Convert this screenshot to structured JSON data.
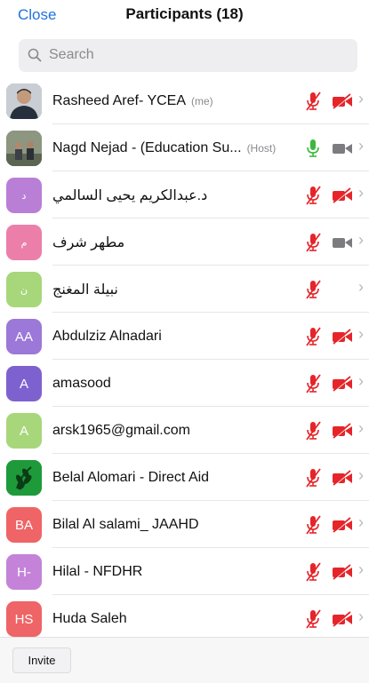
{
  "header": {
    "close_label": "Close",
    "title": "Participants (18)"
  },
  "search": {
    "placeholder": "Search",
    "icon": "search-icon"
  },
  "colors": {
    "accent": "#1f72e0",
    "muted_red": "#e5252a",
    "unmuted_green": "#3cb93c",
    "cam_off_red": "#e5252a",
    "cam_on_gray": "#7b7b80"
  },
  "participants": [
    {
      "name": "Rasheed Aref- YCEA",
      "tag": "(me)",
      "avatar_text": "",
      "avatar_kind": "photo-man",
      "avatar_color": "#5a6b7d",
      "mic": "muted",
      "cam": "off"
    },
    {
      "name": "Nagd Nejad - (Education Su...",
      "tag": "(Host)",
      "avatar_text": "",
      "avatar_kind": "photo-group",
      "avatar_color": "#6f7a64",
      "mic": "on",
      "cam": "on"
    },
    {
      "name": "د.عبدالكريم يحيى السالمي",
      "tag": "",
      "avatar_text": "د",
      "avatar_kind": "initials",
      "avatar_color": "#b97fd6",
      "mic": "muted",
      "cam": "off"
    },
    {
      "name": "مطهر شرف",
      "tag": "",
      "avatar_text": "م",
      "avatar_kind": "initials",
      "avatar_color": "#ec7fa9",
      "mic": "muted",
      "cam": "on"
    },
    {
      "name": "نبيلة المغنج",
      "tag": "",
      "avatar_text": "ن",
      "avatar_kind": "initials",
      "avatar_color": "#a7d77a",
      "mic": "muted",
      "cam": "none"
    },
    {
      "name": "Abdulziz Alnadari",
      "tag": "",
      "avatar_text": "AA",
      "avatar_kind": "initials",
      "avatar_color": "#9c78d8",
      "mic": "muted",
      "cam": "off"
    },
    {
      "name": "amasood",
      "tag": "",
      "avatar_text": "A",
      "avatar_kind": "initials",
      "avatar_color": "#7d62cf",
      "mic": "muted",
      "cam": "off"
    },
    {
      "name": "arsk1965@gmail.com",
      "tag": "",
      "avatar_text": "A",
      "avatar_kind": "initials",
      "avatar_color": "#a7d77a",
      "mic": "muted",
      "cam": "off"
    },
    {
      "name": "Belal Alomari - Direct Aid",
      "tag": "",
      "avatar_text": "",
      "avatar_kind": "leaf",
      "avatar_color": "#1e9a3b",
      "mic": "muted",
      "cam": "off"
    },
    {
      "name": "Bilal Al salami_ JAAHD",
      "tag": "",
      "avatar_text": "BA",
      "avatar_kind": "initials",
      "avatar_color": "#ef6466",
      "mic": "muted",
      "cam": "off"
    },
    {
      "name": "Hilal - NFDHR",
      "tag": "",
      "avatar_text": "H-",
      "avatar_kind": "initials",
      "avatar_color": "#c483d8",
      "mic": "muted",
      "cam": "off"
    },
    {
      "name": "Huda Saleh",
      "tag": "",
      "avatar_text": "HS",
      "avatar_kind": "initials",
      "avatar_color": "#ef6466",
      "mic": "muted",
      "cam": "off"
    }
  ],
  "footer": {
    "invite_label": "Invite"
  }
}
